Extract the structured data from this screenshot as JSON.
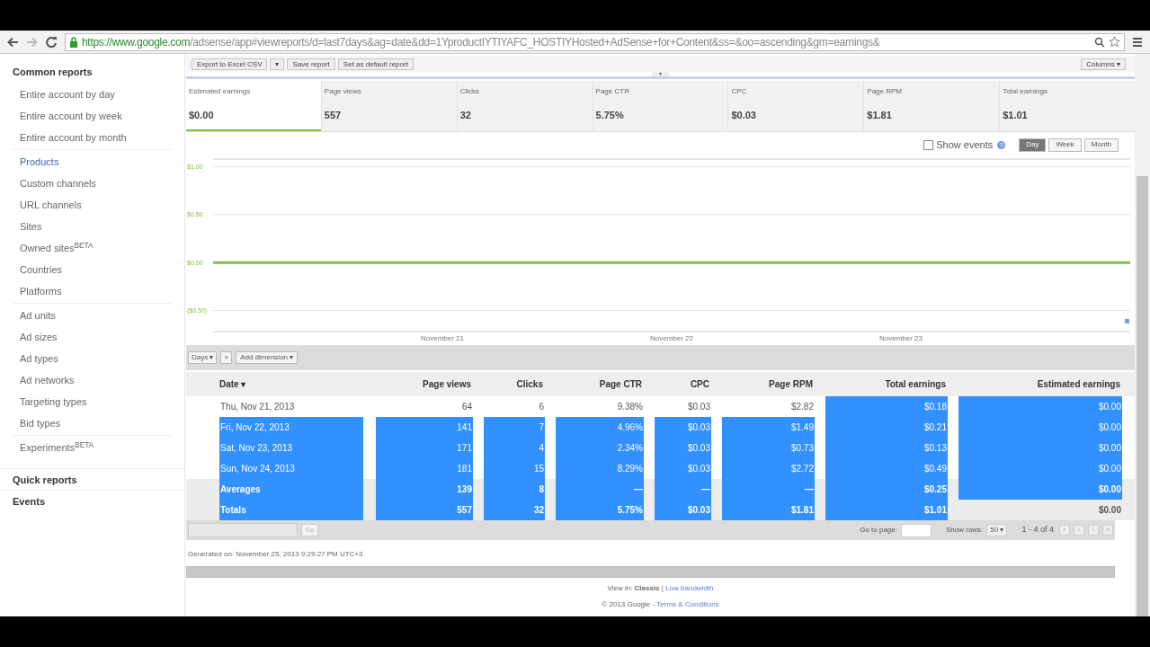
{
  "browser": {
    "url_host": "https://www.google.com",
    "url_path": "/adsense/app#viewreports/d=last7days&ag=date&dd=1YproductIYTIYAFC_HOSTIYHosted+AdSense+for+Content&ss=&oo=ascending&gm=earnings&"
  },
  "sidebar": {
    "sections": [
      {
        "title": "Common reports",
        "groups": [
          [
            {
              "label": "Entire account by day",
              "selected": false
            },
            {
              "label": "Entire account by week",
              "selected": false
            },
            {
              "label": "Entire account by month",
              "selected": false
            }
          ],
          [
            {
              "label": "Products",
              "selected": true
            },
            {
              "label": "Custom channels",
              "selected": false
            },
            {
              "label": "URL channels",
              "selected": false
            },
            {
              "label": "Sites",
              "selected": false
            },
            {
              "label": "Owned sites$^{BETA}$",
              "selected": false
            },
            {
              "label": "Countries",
              "selected": false
            },
            {
              "label": "Platforms",
              "selected": false
            }
          ],
          [
            {
              "label": "Ad units",
              "selected": false
            },
            {
              "label": "Ad sizes",
              "selected": false
            },
            {
              "label": "Ad types",
              "selected": false
            },
            {
              "label": "Ad networks",
              "selected": false
            },
            {
              "label": "Targeting types",
              "selected": false
            },
            {
              "label": "Bid types",
              "selected": false
            }
          ],
          [
            {
              "label": "Experiments$^{BETA}$",
              "selected": false
            }
          ]
        ]
      },
      {
        "title": "Quick reports"
      },
      {
        "title": "Events"
      }
    ]
  },
  "report_toolbar": {
    "buttons": [
      "Export to Excel CSV",
      "▾",
      "Save report",
      "Set as default report"
    ],
    "columns_button": "Columns ▾",
    "collapse": "▾"
  },
  "metrics": [
    {
      "label": "Estimated earnings",
      "value": "$0.00",
      "selected": true
    },
    {
      "label": "Page views",
      "value": "557",
      "selected": false
    },
    {
      "label": "Clicks",
      "value": "32",
      "selected": false
    },
    {
      "label": "Page CTR",
      "value": "5.75%",
      "selected": false
    },
    {
      "label": "CPC",
      "value": "$0.03",
      "selected": false
    },
    {
      "label": "Page RPM",
      "value": "$1.81",
      "selected": false
    },
    {
      "label": "Total earnings",
      "value": "$1.01",
      "selected": false
    }
  ],
  "chart_controls": {
    "show_events": {
      "label": "Show events",
      "checked": false,
      "help": "?"
    },
    "periods": [
      {
        "label": "Day",
        "selected": true
      },
      {
        "label": "Week",
        "selected": false
      },
      {
        "label": "Month",
        "selected": false
      }
    ]
  },
  "chart_data": {
    "type": "line",
    "grid": true,
    "categories": [
      null,
      "November 21",
      "November 22",
      "November 23",
      null
    ],
    "ylim": [
      -0.72,
      1.08
    ],
    "yticks": [
      {
        "value": 1,
        "label": "$1.00"
      },
      {
        "value": 0.5,
        "label": "$0.50"
      },
      {
        "value": 0,
        "label": "$0.00"
      },
      {
        "value": -0.5,
        "label": "($0.50)"
      }
    ],
    "series": [
      {
        "color": "#7cc242",
        "values": [
          0,
          0,
          0,
          0,
          0
        ]
      }
    ]
  },
  "dimensions": {
    "chips": [
      "Days ▾",
      "×"
    ],
    "add": "Add dimension ▾"
  },
  "table": {
    "columns": [
      {
        "label": "Date ▾"
      },
      {
        "label": "Page views"
      },
      {
        "label": "Clicks"
      },
      {
        "label": "Page CTR"
      },
      {
        "label": "CPC"
      },
      {
        "label": "Page RPM"
      },
      {
        "label": "Total earnings"
      },
      {
        "label": "Estimated earnings"
      }
    ],
    "rows": [
      {
        "kind": "day",
        "cells": [
          {
            "text": "Thu, Nov 21, 2013",
            "selected": false
          },
          {
            "text": "64",
            "selected": false
          },
          {
            "text": "6",
            "selected": false
          },
          {
            "text": "9.38%",
            "selected": false
          },
          {
            "text": "$0.03",
            "selected": false
          },
          {
            "text": "$2.82",
            "selected": false
          },
          {
            "text": "$0.18",
            "selected": true
          },
          {
            "text": "$0.00",
            "selected": true
          }
        ]
      },
      {
        "kind": "day",
        "cells": [
          {
            "text": "Fri, Nov 22, 2013",
            "selected": true
          },
          {
            "text": "141",
            "selected": true
          },
          {
            "text": "7",
            "selected": true
          },
          {
            "text": "4.96%",
            "selected": true
          },
          {
            "text": "$0.03",
            "selected": true
          },
          {
            "text": "$1.49",
            "selected": true
          },
          {
            "text": "$0.21",
            "selected": true
          },
          {
            "text": "$0.00",
            "selected": true
          }
        ]
      },
      {
        "kind": "day",
        "cells": [
          {
            "text": "Sat, Nov 23, 2013",
            "selected": true
          },
          {
            "text": "171",
            "selected": true
          },
          {
            "text": "4",
            "selected": true
          },
          {
            "text": "2.34%",
            "selected": true
          },
          {
            "text": "$0.03",
            "selected": true
          },
          {
            "text": "$0.73",
            "selected": true
          },
          {
            "text": "$0.13",
            "selected": true
          },
          {
            "text": "$0.00",
            "selected": true
          }
        ]
      },
      {
        "kind": "day",
        "cells": [
          {
            "text": "Sun, Nov 24, 2013",
            "selected": true
          },
          {
            "text": "181",
            "selected": true
          },
          {
            "text": "15",
            "selected": true
          },
          {
            "text": "8.29%",
            "selected": true
          },
          {
            "text": "$0.03",
            "selected": true
          },
          {
            "text": "$2.72",
            "selected": true
          },
          {
            "text": "$0.49",
            "selected": true
          },
          {
            "text": "$0.00",
            "selected": true
          }
        ]
      },
      {
        "kind": "summary",
        "cells": [
          {
            "text": "Averages",
            "selected": true
          },
          {
            "text": "139",
            "selected": true
          },
          {
            "text": "8",
            "selected": true
          },
          {
            "text": "—",
            "selected": true
          },
          {
            "text": "—",
            "selected": true
          },
          {
            "text": "—",
            "selected": true
          },
          {
            "text": "$0.25",
            "selected": true
          },
          {
            "text": "$0.00",
            "selected": true
          }
        ]
      },
      {
        "kind": "summary",
        "cells": [
          {
            "text": "Totals",
            "selected": true
          },
          {
            "text": "557",
            "selected": true
          },
          {
            "text": "32",
            "selected": true
          },
          {
            "text": "5.75%",
            "selected": true
          },
          {
            "text": "$0.03",
            "selected": true
          },
          {
            "text": "$1.81",
            "selected": true
          },
          {
            "text": "$1.01",
            "selected": true
          },
          {
            "text": "$0.00",
            "selected": false
          }
        ]
      }
    ]
  },
  "pager": {
    "go": "Go",
    "go_to_page": "Go to page:",
    "show_rows": "Show rows:",
    "rows_value": "50 ▾",
    "range": "1 - 4 of 4",
    "nav": [
      "«",
      "‹",
      "›",
      "»"
    ]
  },
  "generated": "Generated on: November 25, 2013 9:29:27 PM UTC+3",
  "footer": {
    "view_in": "View in: **Classic** | ",
    "low_bandwidth": "Low bandwidth",
    "copyright": "© 2013 Google - ",
    "terms": "Terms & Conditions"
  }
}
